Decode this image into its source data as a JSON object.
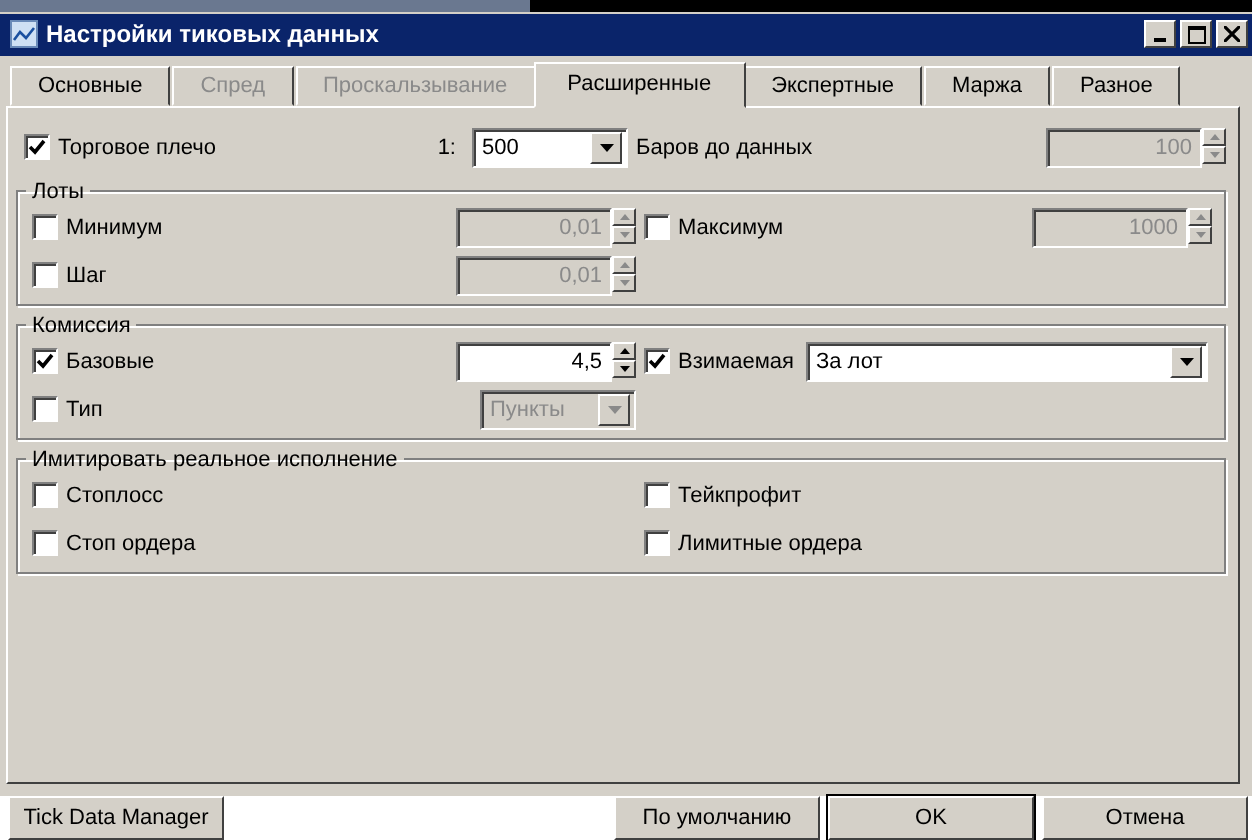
{
  "window": {
    "title": "Настройки тиковых данных"
  },
  "tabs": [
    {
      "label": "Основные",
      "selected": false,
      "disabled": false
    },
    {
      "label": "Спред",
      "selected": false,
      "disabled": true
    },
    {
      "label": "Проскальзывание",
      "selected": false,
      "disabled": true
    },
    {
      "label": "Расширенные",
      "selected": true,
      "disabled": false
    },
    {
      "label": "Экспертные",
      "selected": false,
      "disabled": false
    },
    {
      "label": "Маржа",
      "selected": false,
      "disabled": false
    },
    {
      "label": "Разное",
      "selected": false,
      "disabled": false
    }
  ],
  "top_row": {
    "left": {
      "label": "Торговое плечо",
      "checked": true,
      "prefix": "1:",
      "field": {
        "kind": "combo",
        "value": "500",
        "disabled": false
      }
    },
    "right": {
      "label": "Баров до данных",
      "field": {
        "kind": "spin",
        "value": "100",
        "disabled": true
      }
    }
  },
  "groups": [
    {
      "title": "Лоты",
      "rows": [
        {
          "left": {
            "label": "Минимум",
            "checked": false,
            "field": {
              "kind": "spin",
              "value": "0,01",
              "disabled": true
            }
          },
          "right": {
            "label": "Максимум",
            "checked": false,
            "field": {
              "kind": "spin",
              "value": "1000",
              "disabled": true
            }
          }
        },
        {
          "left": {
            "label": "Шаг",
            "checked": false,
            "field": {
              "kind": "spin",
              "value": "0,01",
              "disabled": true
            }
          }
        }
      ]
    },
    {
      "title": "Комиссия",
      "rows": [
        {
          "left": {
            "label": "Базовые",
            "checked": true,
            "field": {
              "kind": "spin",
              "value": "4,5",
              "disabled": false
            }
          },
          "right": {
            "label": "Взимаемая",
            "checked": true,
            "field": {
              "kind": "wide_combo",
              "value": "За лот",
              "disabled": false
            }
          }
        },
        {
          "left": {
            "label": "Тип",
            "checked": false,
            "field": {
              "kind": "combo",
              "value": "Пункты",
              "disabled": true
            }
          }
        }
      ]
    },
    {
      "title": "Имитировать реальное исполнение",
      "rows": [
        {
          "left": {
            "label": "Стоплосс",
            "checked": false
          },
          "right": {
            "label": "Тейкпрофит",
            "checked": false
          }
        },
        {
          "left": {
            "label": "Стоп ордера",
            "checked": false
          },
          "right": {
            "label": "Лимитные ордера",
            "checked": false
          }
        }
      ]
    }
  ],
  "buttons": [
    {
      "label": "Tick Data Manager",
      "default": false
    },
    {
      "label": "По умолчанию",
      "default": false
    },
    {
      "label": "OK",
      "default": true
    },
    {
      "label": "Отмена",
      "default": false
    }
  ]
}
